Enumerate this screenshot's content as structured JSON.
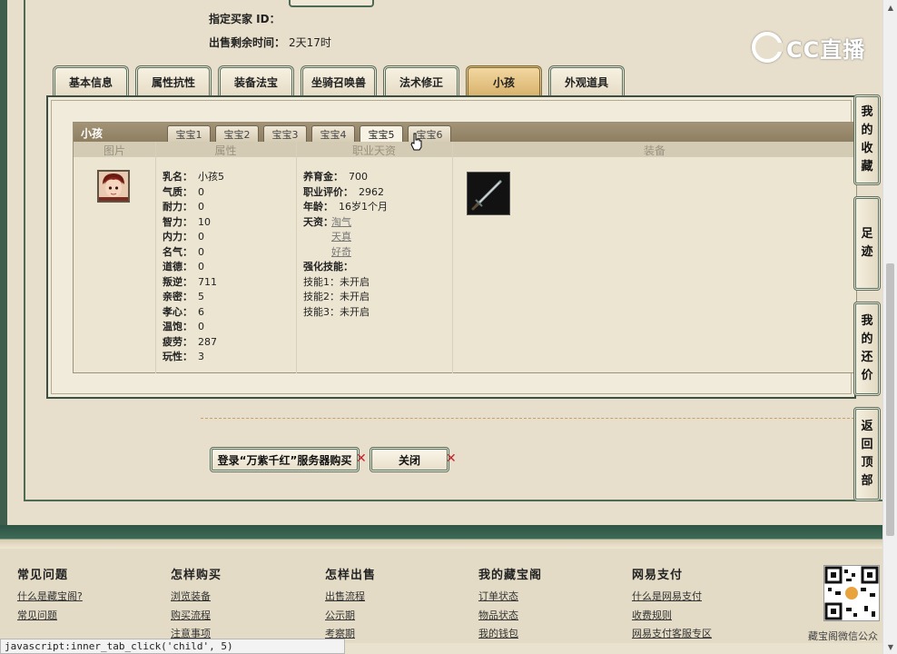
{
  "header": {
    "buyer_label": "指定买家 ID：",
    "remaining_label": "出售剩余时间：",
    "remaining_value": "2天17时"
  },
  "logo": {
    "text": "CC直播"
  },
  "tabs": [
    {
      "label": "基本信息",
      "active": false
    },
    {
      "label": "属性抗性",
      "active": false
    },
    {
      "label": "装备法宝",
      "active": false
    },
    {
      "label": "坐骑召唤兽",
      "active": false
    },
    {
      "label": "法术修正",
      "active": false
    },
    {
      "label": "小孩",
      "active": true
    },
    {
      "label": "外观道具",
      "active": false
    }
  ],
  "child_panel": {
    "title": "小孩",
    "baby_tabs": [
      {
        "label": "宝宝1",
        "active": false
      },
      {
        "label": "宝宝2",
        "active": false
      },
      {
        "label": "宝宝3",
        "active": false
      },
      {
        "label": "宝宝4",
        "active": false
      },
      {
        "label": "宝宝5",
        "active": true
      },
      {
        "label": "宝宝6",
        "active": false
      }
    ],
    "columns": {
      "picture": "图片",
      "attributes": "属性",
      "career": "职业天资",
      "equipment": "装备"
    },
    "attributes": [
      {
        "k": "乳名：",
        "v": "小孩5"
      },
      {
        "k": "气质：",
        "v": "0"
      },
      {
        "k": "耐力：",
        "v": "0"
      },
      {
        "k": "智力：",
        "v": "10"
      },
      {
        "k": "内力：",
        "v": "0"
      },
      {
        "k": "名气：",
        "v": "0"
      },
      {
        "k": "道德：",
        "v": "0"
      },
      {
        "k": "叛逆：",
        "v": "711"
      },
      {
        "k": "亲密：",
        "v": "5"
      },
      {
        "k": "孝心：",
        "v": "6"
      },
      {
        "k": "温饱：",
        "v": "0"
      },
      {
        "k": "疲劳：",
        "v": "287"
      },
      {
        "k": "玩性：",
        "v": "3"
      }
    ],
    "career": {
      "upbringing": {
        "k": "养育金：",
        "v": "700"
      },
      "rating": {
        "k": "职业评价：",
        "v": "2962"
      },
      "age": {
        "k": "年龄：",
        "v": "16岁1个月"
      },
      "talent_label": "天资：",
      "talents": [
        "淘气",
        "天真",
        "好奇"
      ],
      "skill_enhance_label": "强化技能：",
      "skills": [
        {
          "k": "技能1：",
          "v": "未开启"
        },
        {
          "k": "技能2：",
          "v": "未开启"
        },
        {
          "k": "技能3：",
          "v": "未开启"
        }
      ]
    },
    "equipment_icon": "sword-icon"
  },
  "actions": {
    "login_buy": "登录“万紫千红”服务器购买",
    "close": "关闭",
    "x_mark": "✕"
  },
  "side_nav": [
    {
      "label": [
        "我",
        "的",
        "收",
        "藏"
      ]
    },
    {
      "label": [
        "足",
        "迹"
      ]
    },
    {
      "label": [
        "我",
        "的",
        "还",
        "价"
      ]
    },
    {
      "label": [
        "返",
        "回",
        "顶",
        "部"
      ]
    }
  ],
  "footer": {
    "columns": [
      {
        "title": "常见问题",
        "links": [
          "什么是藏宝阁?",
          "常见问题"
        ]
      },
      {
        "title": "怎样购买",
        "links": [
          "浏览装备",
          "购买流程",
          "注意事项"
        ]
      },
      {
        "title": "怎样出售",
        "links": [
          "出售流程",
          "公示期",
          "考察期"
        ]
      },
      {
        "title": "我的藏宝阁",
        "links": [
          "订单状态",
          "物品状态",
          "我的钱包"
        ]
      },
      {
        "title": "网易支付",
        "links": [
          "什么是网易支付",
          "收费规则",
          "网易支付客服专区"
        ]
      }
    ],
    "qr_caption": "藏宝阁微信公众"
  },
  "status_bar": {
    "text": "javascript:inner_tab_click('child', 5)"
  },
  "colors": {
    "tab_active": "#d9b36e",
    "frame_green": "#3f5d4c",
    "x_red": "#c0262d"
  }
}
